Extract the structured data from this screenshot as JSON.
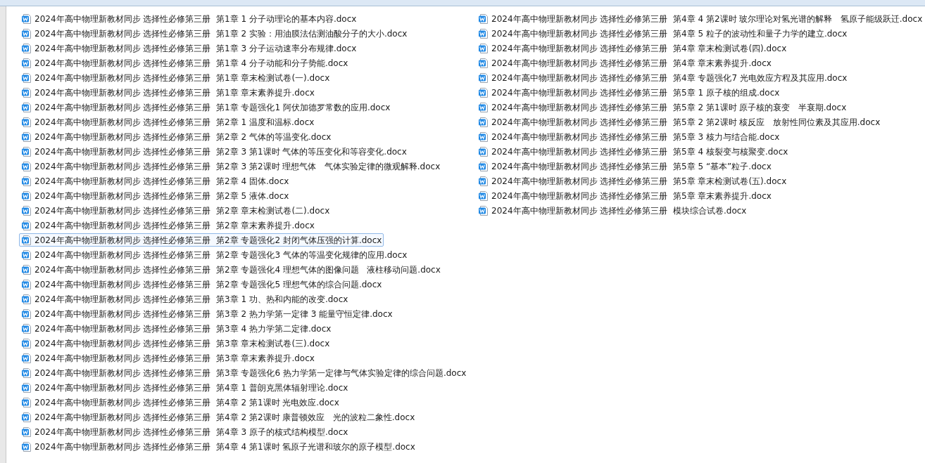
{
  "files": [
    {
      "name": "2024年高中物理新教材同步 选择性必修第三册  第1章 1 分子动理论的基本内容.docx",
      "selected": false
    },
    {
      "name": "2024年高中物理新教材同步 选择性必修第三册  第1章 2 实验：用油膜法估测油酸分子的大小.docx",
      "selected": false
    },
    {
      "name": "2024年高中物理新教材同步 选择性必修第三册  第1章 3 分子运动速率分布规律.docx",
      "selected": false
    },
    {
      "name": "2024年高中物理新教材同步 选择性必修第三册  第1章 4 分子动能和分子势能.docx",
      "selected": false
    },
    {
      "name": "2024年高中物理新教材同步 选择性必修第三册  第1章 章末检测试卷(一).docx",
      "selected": false
    },
    {
      "name": "2024年高中物理新教材同步 选择性必修第三册  第1章 章末素养提升.docx",
      "selected": false
    },
    {
      "name": "2024年高中物理新教材同步 选择性必修第三册  第1章 专题强化1 阿伏加德罗常数的应用.docx",
      "selected": false
    },
    {
      "name": "2024年高中物理新教材同步 选择性必修第三册  第2章 1 温度和温标.docx",
      "selected": false
    },
    {
      "name": "2024年高中物理新教材同步 选择性必修第三册  第2章 2 气体的等温变化.docx",
      "selected": false
    },
    {
      "name": "2024年高中物理新教材同步 选择性必修第三册  第2章 3 第1课时 气体的等压变化和等容变化.docx",
      "selected": false
    },
    {
      "name": "2024年高中物理新教材同步 选择性必修第三册  第2章 3 第2课时 理想气体   气体实验定律的微观解释.docx",
      "selected": false
    },
    {
      "name": "2024年高中物理新教材同步 选择性必修第三册  第2章 4 固体.docx",
      "selected": false
    },
    {
      "name": "2024年高中物理新教材同步 选择性必修第三册  第2章 5 液体.docx",
      "selected": false
    },
    {
      "name": "2024年高中物理新教材同步 选择性必修第三册  第2章 章末检测试卷(二).docx",
      "selected": false
    },
    {
      "name": "2024年高中物理新教材同步 选择性必修第三册  第2章 章末素养提升.docx",
      "selected": false
    },
    {
      "name": "2024年高中物理新教材同步 选择性必修第三册  第2章 专题强化2 封闭气体压强的计算.docx",
      "selected": true
    },
    {
      "name": "2024年高中物理新教材同步 选择性必修第三册  第2章 专题强化3 气体的等温变化规律的应用.docx",
      "selected": false
    },
    {
      "name": "2024年高中物理新教材同步 选择性必修第三册  第2章 专题强化4 理想气体的图像问题   液柱移动问题.docx",
      "selected": false
    },
    {
      "name": "2024年高中物理新教材同步 选择性必修第三册  第2章 专题强化5 理想气体的综合问题.docx",
      "selected": false
    },
    {
      "name": "2024年高中物理新教材同步 选择性必修第三册  第3章 1 功、热和内能的改变.docx",
      "selected": false
    },
    {
      "name": "2024年高中物理新教材同步 选择性必修第三册  第3章 2 热力学第一定律 3 能量守恒定律.docx",
      "selected": false
    },
    {
      "name": "2024年高中物理新教材同步 选择性必修第三册  第3章 4 热力学第二定律.docx",
      "selected": false
    },
    {
      "name": "2024年高中物理新教材同步 选择性必修第三册  第3章 章末检测试卷(三).docx",
      "selected": false
    },
    {
      "name": "2024年高中物理新教材同步 选择性必修第三册  第3章 章末素养提升.docx",
      "selected": false
    },
    {
      "name": "2024年高中物理新教材同步 选择性必修第三册  第3章 专题强化6 热力学第一定律与气体实验定律的综合问题.docx",
      "selected": false
    },
    {
      "name": "2024年高中物理新教材同步 选择性必修第三册  第4章 1 普朗克黑体辐射理论.docx",
      "selected": false
    },
    {
      "name": "2024年高中物理新教材同步 选择性必修第三册  第4章 2 第1课时 光电效应.docx",
      "selected": false
    },
    {
      "name": "2024年高中物理新教材同步 选择性必修第三册  第4章 2 第2课时 康普顿效应   光的波粒二象性.docx",
      "selected": false
    },
    {
      "name": "2024年高中物理新教材同步 选择性必修第三册  第4章 3 原子的核式结构模型.docx",
      "selected": false
    },
    {
      "name": "2024年高中物理新教材同步 选择性必修第三册  第4章 4 第1课时 氢原子光谱和玻尔的原子模型.docx",
      "selected": false
    },
    {
      "name": "2024年高中物理新教材同步 选择性必修第三册  第4章 4 第2课时 玻尔理论对氢光谱的解释   氢原子能级跃迁.docx",
      "selected": false
    },
    {
      "name": "2024年高中物理新教材同步 选择性必修第三册  第4章 5 粒子的波动性和量子力学的建立.docx",
      "selected": false
    },
    {
      "name": "2024年高中物理新教材同步 选择性必修第三册  第4章 章末检测试卷(四).docx",
      "selected": false
    },
    {
      "name": "2024年高中物理新教材同步 选择性必修第三册  第4章 章末素养提升.docx",
      "selected": false
    },
    {
      "name": "2024年高中物理新教材同步 选择性必修第三册  第4章 专题强化7 光电效应方程及其应用.docx",
      "selected": false
    },
    {
      "name": "2024年高中物理新教材同步 选择性必修第三册  第5章 1 原子核的组成.docx",
      "selected": false
    },
    {
      "name": "2024年高中物理新教材同步 选择性必修第三册  第5章 2 第1课时 原子核的衰变   半衰期.docx",
      "selected": false
    },
    {
      "name": "2024年高中物理新教材同步 选择性必修第三册  第5章 2 第2课时 核反应   放射性同位素及其应用.docx",
      "selected": false
    },
    {
      "name": "2024年高中物理新教材同步 选择性必修第三册  第5章 3 核力与结合能.docx",
      "selected": false
    },
    {
      "name": "2024年高中物理新教材同步 选择性必修第三册  第5章 4 核裂变与核聚变.docx",
      "selected": false
    },
    {
      "name": "2024年高中物理新教材同步 选择性必修第三册  第5章 5 “基本”粒子.docx",
      "selected": false
    },
    {
      "name": "2024年高中物理新教材同步 选择性必修第三册  第5章 章末检测试卷(五).docx",
      "selected": false
    },
    {
      "name": "2024年高中物理新教材同步 选择性必修第三册  第5章 章末素养提升.docx",
      "selected": false
    },
    {
      "name": "2024年高中物理新教材同步 选择性必修第三册  模块综合试卷.docx",
      "selected": false
    }
  ]
}
